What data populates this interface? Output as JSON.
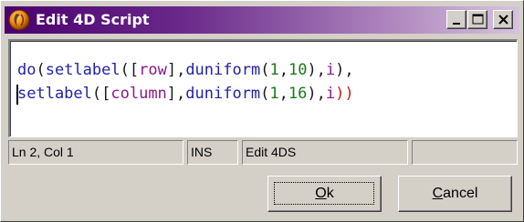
{
  "window": {
    "title": "Edit 4D Script",
    "icon": "orange-sphere-4d-icon",
    "caption_buttons": {
      "minimize": "minimize-icon",
      "maximize": "maximize-icon",
      "close": "close-icon"
    }
  },
  "editor": {
    "lines": [
      [
        {
          "text": "do",
          "kind": "keyword"
        },
        {
          "text": "(",
          "kind": "paren"
        },
        {
          "text": "setlabel",
          "kind": "keyword"
        },
        {
          "text": "([",
          "kind": "paren"
        },
        {
          "text": "row",
          "kind": "ident"
        },
        {
          "text": "],",
          "kind": "paren"
        },
        {
          "text": "duniform",
          "kind": "keyword"
        },
        {
          "text": "(",
          "kind": "paren"
        },
        {
          "text": "1",
          "kind": "number"
        },
        {
          "text": ",",
          "kind": "paren"
        },
        {
          "text": "10",
          "kind": "number"
        },
        {
          "text": "),",
          "kind": "paren"
        },
        {
          "text": "i",
          "kind": "ident"
        },
        {
          "text": "),",
          "kind": "paren"
        }
      ],
      [
        {
          "text": "setlabel",
          "kind": "keyword"
        },
        {
          "text": "([",
          "kind": "paren"
        },
        {
          "text": "column",
          "kind": "ident"
        },
        {
          "text": "],",
          "kind": "paren"
        },
        {
          "text": "duniform",
          "kind": "keyword"
        },
        {
          "text": "(",
          "kind": "paren"
        },
        {
          "text": "1",
          "kind": "number"
        },
        {
          "text": ",",
          "kind": "paren"
        },
        {
          "text": "16",
          "kind": "number"
        },
        {
          "text": "),",
          "kind": "paren"
        },
        {
          "text": "i",
          "kind": "ident"
        },
        {
          "text": "))",
          "kind": "closing"
        }
      ]
    ],
    "syntax_colors": {
      "keyword": "#2222aa",
      "paren": "#1a1a1a",
      "ident": "#8a1a8a",
      "number": "#1a7a1a",
      "closing": "#cc1a1a"
    }
  },
  "status": {
    "position": "Ln 2, Col 1",
    "mode": "INS",
    "title": "Edit 4DS",
    "extra": ""
  },
  "buttons": {
    "ok": {
      "mnemonic": "O",
      "rest": "k"
    },
    "cancel": {
      "mnemonic": "C",
      "rest": "ancel"
    }
  },
  "colors": {
    "title_gradient_start": "#4a006e",
    "title_gradient_end": "#d7c3de",
    "face": "#d4d0c8"
  }
}
